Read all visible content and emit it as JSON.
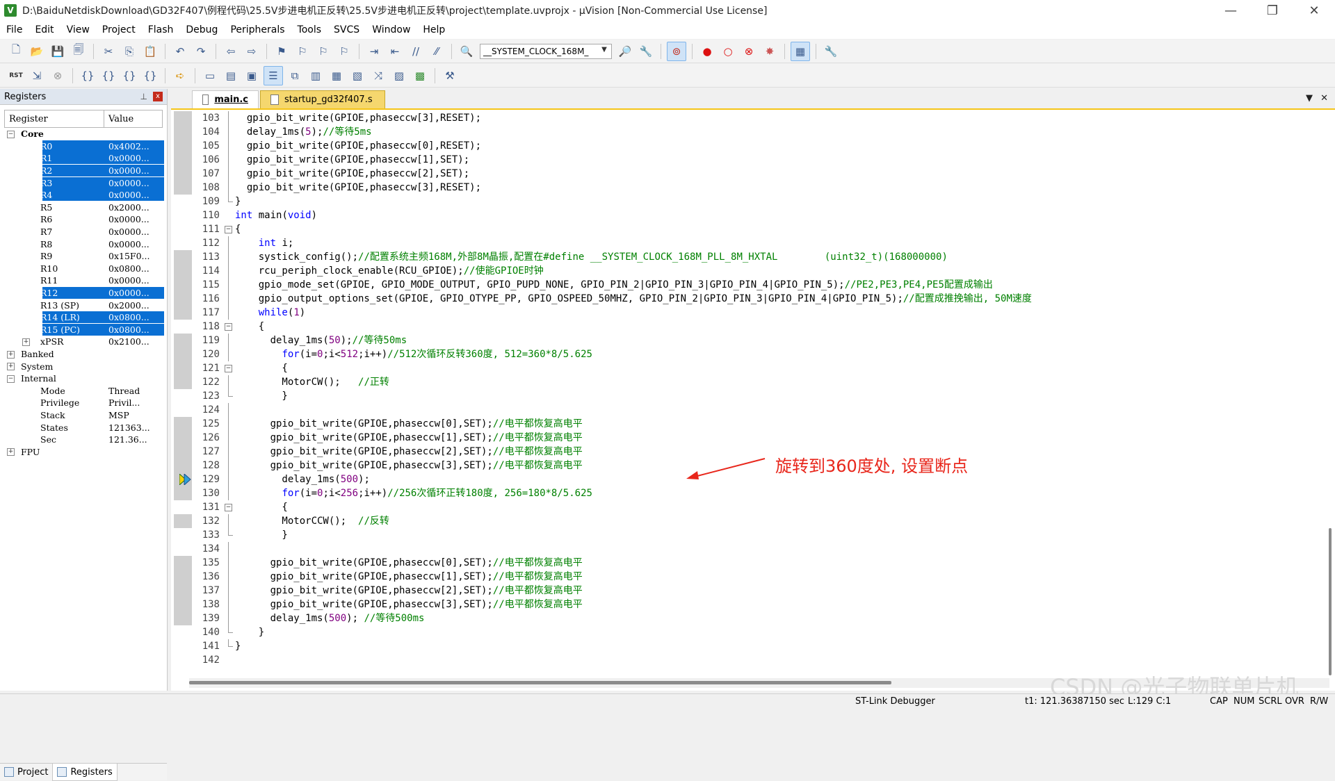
{
  "window": {
    "title": "D:\\BaiduNetdiskDownload\\GD32F407\\例程代码\\25.5V步进电机正反转\\25.5V步进电机正反转\\project\\template.uvprojx - µVision  [Non-Commercial Use License]",
    "minimize": "—",
    "maximize": "❐",
    "close": "✕"
  },
  "menu": [
    "File",
    "Edit",
    "View",
    "Project",
    "Flash",
    "Debug",
    "Peripherals",
    "Tools",
    "SVCS",
    "Window",
    "Help"
  ],
  "toolbar": {
    "define_combo": "__SYSTEM_CLOCK_168M_"
  },
  "registers_panel": {
    "title": "Registers",
    "pin": "📌",
    "close": "x",
    "col_register": "Register",
    "col_value": "Value",
    "rows": [
      {
        "name": "Core",
        "value": "",
        "level": 0,
        "expander": "−",
        "bold": true,
        "selected": false
      },
      {
        "name": "R0",
        "value": "0x4002...",
        "level": 2,
        "selected": true
      },
      {
        "name": "R1",
        "value": "0x0000...",
        "level": 2,
        "selected": true
      },
      {
        "name": "R2",
        "value": "0x0000...",
        "level": 2,
        "selected": true
      },
      {
        "name": "R3",
        "value": "0x0000...",
        "level": 2,
        "selected": true
      },
      {
        "name": "R4",
        "value": "0x0000...",
        "level": 2,
        "selected": true
      },
      {
        "name": "R5",
        "value": "0x2000...",
        "level": 2,
        "selected": false
      },
      {
        "name": "R6",
        "value": "0x0000...",
        "level": 2,
        "selected": false
      },
      {
        "name": "R7",
        "value": "0x0000...",
        "level": 2,
        "selected": false
      },
      {
        "name": "R8",
        "value": "0x0000...",
        "level": 2,
        "selected": false
      },
      {
        "name": "R9",
        "value": "0x15F0...",
        "level": 2,
        "selected": false
      },
      {
        "name": "R10",
        "value": "0x0800...",
        "level": 2,
        "selected": false
      },
      {
        "name": "R11",
        "value": "0x0000...",
        "level": 2,
        "selected": false
      },
      {
        "name": "R12",
        "value": "0x0000...",
        "level": 2,
        "selected": true
      },
      {
        "name": "R13 (SP)",
        "value": "0x2000...",
        "level": 2,
        "selected": false
      },
      {
        "name": "R14 (LR)",
        "value": "0x0800...",
        "level": 2,
        "selected": true
      },
      {
        "name": "R15 (PC)",
        "value": "0x0800...",
        "level": 2,
        "selected": true
      },
      {
        "name": "xPSR",
        "value": "0x2100...",
        "level": 1,
        "expander": "+",
        "selected": false
      },
      {
        "name": "Banked",
        "value": "",
        "level": 0,
        "expander": "+",
        "selected": false
      },
      {
        "name": "System",
        "value": "",
        "level": 0,
        "expander": "+",
        "selected": false
      },
      {
        "name": "Internal",
        "value": "",
        "level": 0,
        "expander": "−",
        "selected": false
      },
      {
        "name": "Mode",
        "value": "Thread",
        "level": 2,
        "selected": false
      },
      {
        "name": "Privilege",
        "value": "Privil...",
        "level": 2,
        "selected": false
      },
      {
        "name": "Stack",
        "value": "MSP",
        "level": 2,
        "selected": false
      },
      {
        "name": "States",
        "value": "121363...",
        "level": 2,
        "selected": false
      },
      {
        "name": "Sec",
        "value": "121.36...",
        "level": 2,
        "selected": false
      },
      {
        "name": "FPU",
        "value": "",
        "level": 0,
        "expander": "+",
        "selected": false
      }
    ],
    "tabs": [
      "Project",
      "Registers"
    ]
  },
  "editor": {
    "tabs": [
      "main.c",
      "startup_gd32f407.s"
    ],
    "current_line": 129,
    "lines": [
      {
        "n": 103,
        "fold": "line",
        "mark": true,
        "parts": [
          [
            "t",
            "  gpio_bit_write(GPIOE,phaseccw[3],RESET);"
          ]
        ]
      },
      {
        "n": 104,
        "fold": "line",
        "mark": true,
        "parts": [
          [
            "t",
            "  delay_1ms("
          ],
          [
            "n",
            "5"
          ],
          [
            "t",
            ");"
          ],
          [
            "c",
            "//等待5ms"
          ]
        ]
      },
      {
        "n": 105,
        "fold": "line",
        "mark": true,
        "parts": [
          [
            "t",
            "  gpio_bit_write(GPIOE,phaseccw[0],RESET);"
          ]
        ]
      },
      {
        "n": 106,
        "fold": "line",
        "mark": true,
        "parts": [
          [
            "t",
            "  gpio_bit_write(GPIOE,phaseccw[1],SET);"
          ]
        ]
      },
      {
        "n": 107,
        "fold": "line",
        "mark": true,
        "parts": [
          [
            "t",
            "  gpio_bit_write(GPIOE,phaseccw[2],SET);"
          ]
        ]
      },
      {
        "n": 108,
        "fold": "line",
        "mark": true,
        "parts": [
          [
            "t",
            "  gpio_bit_write(GPIOE,phaseccw[3],RESET);"
          ]
        ]
      },
      {
        "n": 109,
        "fold": "end",
        "mark": false,
        "parts": [
          [
            "t",
            "}"
          ]
        ]
      },
      {
        "n": 110,
        "fold": "",
        "mark": false,
        "parts": [
          [
            "k",
            "int"
          ],
          [
            "t",
            " main("
          ],
          [
            "k",
            "void"
          ],
          [
            "t",
            ")"
          ]
        ]
      },
      {
        "n": 111,
        "fold": "box",
        "mark": false,
        "parts": [
          [
            "t",
            "{"
          ]
        ]
      },
      {
        "n": 112,
        "fold": "line",
        "mark": false,
        "parts": [
          [
            "t",
            "    "
          ],
          [
            "k",
            "int"
          ],
          [
            "t",
            " i;"
          ]
        ]
      },
      {
        "n": 113,
        "fold": "line",
        "mark": true,
        "parts": [
          [
            "t",
            "    systick_config();"
          ],
          [
            "c",
            "//配置系统主频168M,外部8M晶振,配置在#define __SYSTEM_CLOCK_168M_PLL_8M_HXTAL        (uint32_t)(168000000)"
          ]
        ]
      },
      {
        "n": 114,
        "fold": "line",
        "mark": true,
        "parts": [
          [
            "t",
            "    rcu_periph_clock_enable(RCU_GPIOE);"
          ],
          [
            "c",
            "//使能GPIOE时钟"
          ]
        ]
      },
      {
        "n": 115,
        "fold": "line",
        "mark": true,
        "parts": [
          [
            "t",
            "    gpio_mode_set(GPIOE, GPIO_MODE_OUTPUT, GPIO_PUPD_NONE, GPIO_PIN_2|GPIO_PIN_3|GPIO_PIN_4|GPIO_PIN_5);"
          ],
          [
            "c",
            "//PE2,PE3,PE4,PE5配置成输出"
          ]
        ]
      },
      {
        "n": 116,
        "fold": "line",
        "mark": true,
        "parts": [
          [
            "t",
            "    gpio_output_options_set(GPIOE, GPIO_OTYPE_PP, GPIO_OSPEED_50MHZ, GPIO_PIN_2|GPIO_PIN_3|GPIO_PIN_4|GPIO_PIN_5);"
          ],
          [
            "c",
            "//配置成推挽输出, 50M速度"
          ]
        ]
      },
      {
        "n": 117,
        "fold": "line",
        "mark": true,
        "parts": [
          [
            "t",
            "    "
          ],
          [
            "k",
            "while"
          ],
          [
            "t",
            "("
          ],
          [
            "n",
            "1"
          ],
          [
            "t",
            ")"
          ]
        ]
      },
      {
        "n": 118,
        "fold": "box",
        "mark": false,
        "parts": [
          [
            "t",
            "    {"
          ]
        ]
      },
      {
        "n": 119,
        "fold": "line",
        "mark": true,
        "parts": [
          [
            "t",
            "      delay_1ms("
          ],
          [
            "n",
            "50"
          ],
          [
            "t",
            ");"
          ],
          [
            "c",
            "//等待50ms"
          ]
        ]
      },
      {
        "n": 120,
        "fold": "line",
        "mark": true,
        "parts": [
          [
            "t",
            "        "
          ],
          [
            "k",
            "for"
          ],
          [
            "t",
            "(i="
          ],
          [
            "n",
            "0"
          ],
          [
            "t",
            ";i<"
          ],
          [
            "n",
            "512"
          ],
          [
            "t",
            ";i++)"
          ],
          [
            "c",
            "//512次循环反转360度, 512=360*8/5.625"
          ]
        ]
      },
      {
        "n": 121,
        "fold": "box",
        "mark": true,
        "parts": [
          [
            "t",
            "        {"
          ]
        ]
      },
      {
        "n": 122,
        "fold": "line",
        "mark": true,
        "parts": [
          [
            "t",
            "        MotorCW();   "
          ],
          [
            "c",
            "//正转"
          ]
        ]
      },
      {
        "n": 123,
        "fold": "end",
        "mark": false,
        "parts": [
          [
            "t",
            "        }"
          ]
        ]
      },
      {
        "n": 124,
        "fold": "line",
        "mark": false,
        "parts": [
          [
            "t",
            ""
          ]
        ]
      },
      {
        "n": 125,
        "fold": "line",
        "mark": true,
        "parts": [
          [
            "t",
            "      gpio_bit_write(GPIOE,phaseccw[0],SET);"
          ],
          [
            "c",
            "//电平都恢复高电平"
          ]
        ]
      },
      {
        "n": 126,
        "fold": "line",
        "mark": true,
        "parts": [
          [
            "t",
            "      gpio_bit_write(GPIOE,phaseccw[1],SET);"
          ],
          [
            "c",
            "//电平都恢复高电平"
          ]
        ]
      },
      {
        "n": 127,
        "fold": "line",
        "mark": true,
        "parts": [
          [
            "t",
            "      gpio_bit_write(GPIOE,phaseccw[2],SET);"
          ],
          [
            "c",
            "//电平都恢复高电平"
          ]
        ]
      },
      {
        "n": 128,
        "fold": "line",
        "mark": true,
        "parts": [
          [
            "t",
            "      gpio_bit_write(GPIOE,phaseccw[3],SET);"
          ],
          [
            "c",
            "//电平都恢复高电平"
          ]
        ]
      },
      {
        "n": 129,
        "fold": "line",
        "mark": true,
        "parts": [
          [
            "t",
            "        delay_1ms("
          ],
          [
            "n",
            "500"
          ],
          [
            "t",
            ");"
          ]
        ]
      },
      {
        "n": 130,
        "fold": "line",
        "mark": true,
        "parts": [
          [
            "t",
            "        "
          ],
          [
            "k",
            "for"
          ],
          [
            "t",
            "(i="
          ],
          [
            "n",
            "0"
          ],
          [
            "t",
            ";i<"
          ],
          [
            "n",
            "256"
          ],
          [
            "t",
            ";i++)"
          ],
          [
            "c",
            "//256次循环正转180度, 256=180*8/5.625"
          ]
        ]
      },
      {
        "n": 131,
        "fold": "box",
        "mark": false,
        "parts": [
          [
            "t",
            "        {"
          ]
        ]
      },
      {
        "n": 132,
        "fold": "line",
        "mark": true,
        "parts": [
          [
            "t",
            "        MotorCCW();  "
          ],
          [
            "c",
            "//反转"
          ]
        ]
      },
      {
        "n": 133,
        "fold": "end",
        "mark": false,
        "parts": [
          [
            "t",
            "        }"
          ]
        ]
      },
      {
        "n": 134,
        "fold": "line",
        "mark": false,
        "parts": [
          [
            "t",
            ""
          ]
        ]
      },
      {
        "n": 135,
        "fold": "line",
        "mark": true,
        "parts": [
          [
            "t",
            "      gpio_bit_write(GPIOE,phaseccw[0],SET);"
          ],
          [
            "c",
            "//电平都恢复高电平"
          ]
        ]
      },
      {
        "n": 136,
        "fold": "line",
        "mark": true,
        "parts": [
          [
            "t",
            "      gpio_bit_write(GPIOE,phaseccw[1],SET);"
          ],
          [
            "c",
            "//电平都恢复高电平"
          ]
        ]
      },
      {
        "n": 137,
        "fold": "line",
        "mark": true,
        "parts": [
          [
            "t",
            "      gpio_bit_write(GPIOE,phaseccw[2],SET);"
          ],
          [
            "c",
            "//电平都恢复高电平"
          ]
        ]
      },
      {
        "n": 138,
        "fold": "line",
        "mark": true,
        "parts": [
          [
            "t",
            "      gpio_bit_write(GPIOE,phaseccw[3],SET);"
          ],
          [
            "c",
            "//电平都恢复高电平"
          ]
        ]
      },
      {
        "n": 139,
        "fold": "line",
        "mark": true,
        "parts": [
          [
            "t",
            "      delay_1ms("
          ],
          [
            "n",
            "500"
          ],
          [
            "t",
            "); "
          ],
          [
            "c",
            "//等待500ms"
          ]
        ]
      },
      {
        "n": 140,
        "fold": "end",
        "mark": false,
        "parts": [
          [
            "t",
            "    }"
          ]
        ]
      },
      {
        "n": 141,
        "fold": "end",
        "mark": false,
        "parts": [
          [
            "t",
            "}"
          ]
        ]
      },
      {
        "n": 142,
        "fold": "",
        "mark": false,
        "parts": [
          [
            "t",
            ""
          ]
        ]
      }
    ],
    "annotation": "旋转到360度处, 设置断点",
    "watermark": "CSDN @光子物联单片机"
  },
  "status": {
    "debugger": "ST-Link Debugger",
    "time": "t1: 121.36387150 sec",
    "position": "L:129 C:1",
    "cap": "CAP",
    "num": "NUM",
    "scrl": "SCRL",
    "ovr": "OVR",
    "rw": "R/W"
  },
  "colors": {
    "selection": "#0a6fd3",
    "keyword": "#0000ff",
    "comment": "#008000",
    "number": "#800080",
    "annotation": "#e8261b",
    "active_tab": "#f5d76e"
  }
}
